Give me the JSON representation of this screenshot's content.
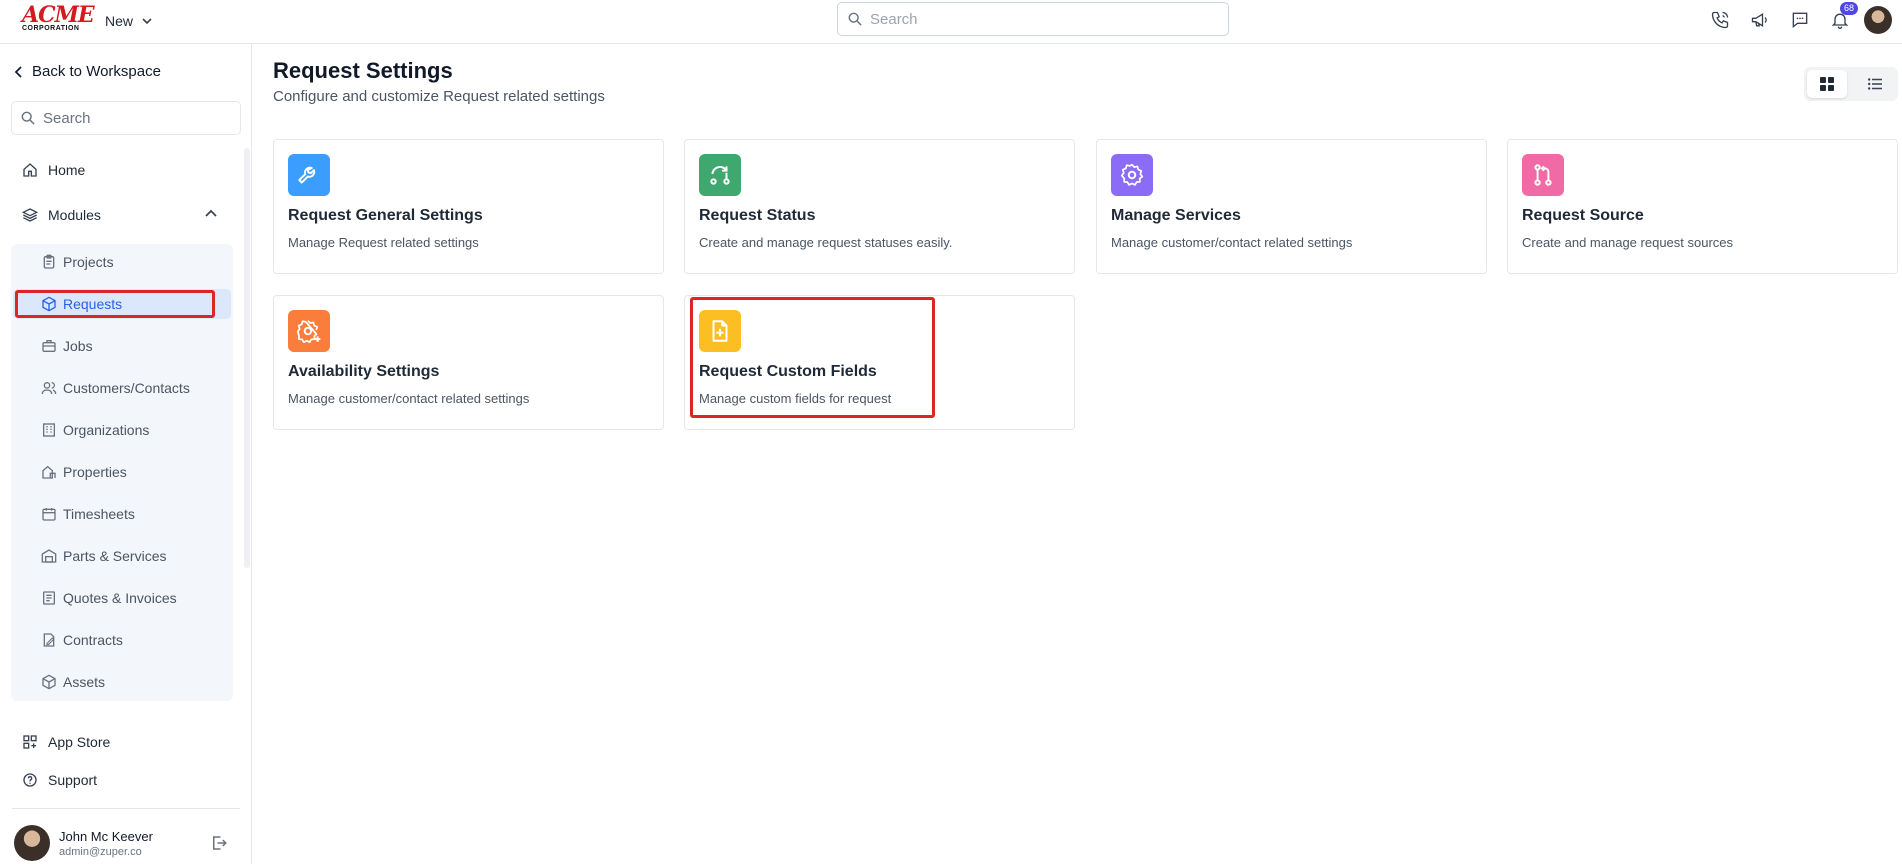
{
  "header": {
    "logo_main": "ACME",
    "logo_sub": "CORPORATION",
    "new_label": "New",
    "search_placeholder": "Search",
    "notification_count": "68"
  },
  "sidebar": {
    "back_label": "Back to Workspace",
    "search_placeholder": "Search",
    "home_label": "Home",
    "modules_label": "Modules",
    "modules": [
      {
        "label": "Projects",
        "icon": "clipboard-icon"
      },
      {
        "label": "Requests",
        "icon": "box-icon",
        "active": true
      },
      {
        "label": "Jobs",
        "icon": "briefcase-icon"
      },
      {
        "label": "Customers/Contacts",
        "icon": "users-icon"
      },
      {
        "label": "Organizations",
        "icon": "building-icon"
      },
      {
        "label": "Properties",
        "icon": "property-icon"
      },
      {
        "label": "Timesheets",
        "icon": "calendar-icon"
      },
      {
        "label": "Parts & Services",
        "icon": "warehouse-icon"
      },
      {
        "label": "Quotes & Invoices",
        "icon": "invoice-icon"
      },
      {
        "label": "Contracts",
        "icon": "contract-icon"
      },
      {
        "label": "Assets",
        "icon": "cube-icon"
      }
    ],
    "app_store_label": "App Store",
    "support_label": "Support",
    "user": {
      "name": "John Mc Keever",
      "email": "admin@zuper.co"
    }
  },
  "main": {
    "title": "Request Settings",
    "subtitle": "Configure and customize Request related settings",
    "cards": [
      {
        "title": "Request General Settings",
        "desc": "Manage Request related settings",
        "icon": "wrench-icon",
        "color": "#3b9eff"
      },
      {
        "title": "Request Status",
        "desc": "Create and manage request statuses easily.",
        "icon": "status-flow-icon",
        "color": "#3fa86e"
      },
      {
        "title": "Manage Services",
        "desc": "Manage customer/contact related settings",
        "icon": "gear-icon",
        "color": "#8b6cf6"
      },
      {
        "title": "Request Source",
        "desc": "Create and manage request sources",
        "icon": "git-branch-icon",
        "color": "#f06aa6"
      },
      {
        "title": "Availability Settings",
        "desc": "Manage customer/contact related settings",
        "icon": "gear-plus-icon",
        "color": "#fb7d3c"
      },
      {
        "title": "Request Custom Fields",
        "desc": "Manage custom fields for request",
        "icon": "file-plus-icon",
        "color": "#fbbf24"
      }
    ]
  }
}
